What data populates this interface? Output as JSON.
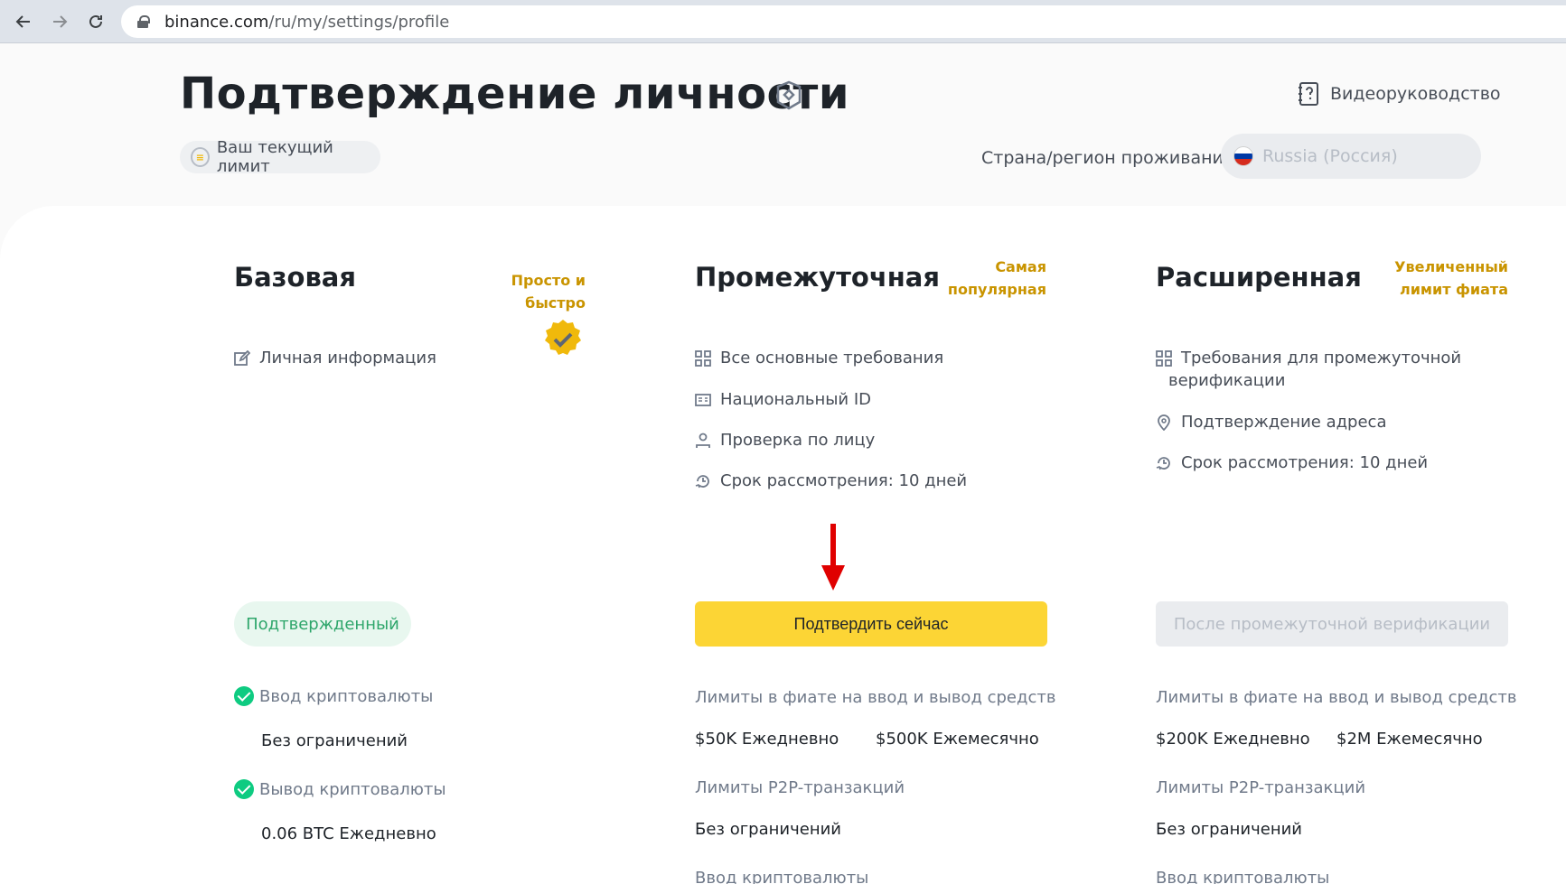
{
  "browser": {
    "url_host": "binance.com",
    "url_path": "/ru/my/settings/profile"
  },
  "header": {
    "title": "Подтверждение личности",
    "video_guide": "Видеоруководство",
    "current_limit": "Ваш текущий лимит",
    "country_label": "Страна/регион проживания:",
    "country_value": "Russia (Россия)"
  },
  "tiers": [
    {
      "title": "Базовая",
      "tag": "Просто и быстро",
      "features": [
        "Личная информация"
      ],
      "status": "Подтвержденный",
      "limits": {
        "crypto_in_label": "Ввод криптовалюты",
        "crypto_in_value": "Без ограничений",
        "crypto_out_label": "Вывод криптовалюты",
        "crypto_out_value": "0.06 BTC Ежедневно"
      }
    },
    {
      "title": "Промежуточная",
      "tag_line1": "Самая",
      "tag_line2": "популярная",
      "features": [
        "Все основные требования",
        "Национальный ID",
        "Проверка по лицу",
        "Срок рассмотрения: 10 дней"
      ],
      "button": "Подтвердить сейчас",
      "limits": {
        "fiat_label": "Лимиты в фиате на ввод и вывод средств",
        "fiat_daily": "$50K Ежедневно",
        "fiat_monthly": "$500K Ежемесячно",
        "p2p_label": "Лимиты P2P-транзакций",
        "p2p_value": "Без ограничений",
        "crypto_in_label": "Ввод криптовалюты"
      }
    },
    {
      "title": "Расширенная",
      "tag_line1": "Увеличенный",
      "tag_line2": "лимит фиата",
      "features": [
        "Требования для промежуточной",
        "верификации",
        "Подтверждение адреса",
        "Срок рассмотрения: 10 дней"
      ],
      "button": "После промежуточной верификации",
      "limits": {
        "fiat_label": "Лимиты в фиате на ввод и вывод средств",
        "fiat_daily": "$200K Ежедневно",
        "fiat_monthly": "$2M Ежемесячно",
        "p2p_label": "Лимиты P2P-транзакций",
        "p2p_value": "Без ограничений",
        "crypto_in_label": "Ввод криптовалюты"
      }
    }
  ],
  "colors": {
    "accent_yellow": "#fcd535",
    "tag_gold": "#c99400",
    "success_green": "#0ecb81",
    "arrow_red": "#e00000"
  }
}
